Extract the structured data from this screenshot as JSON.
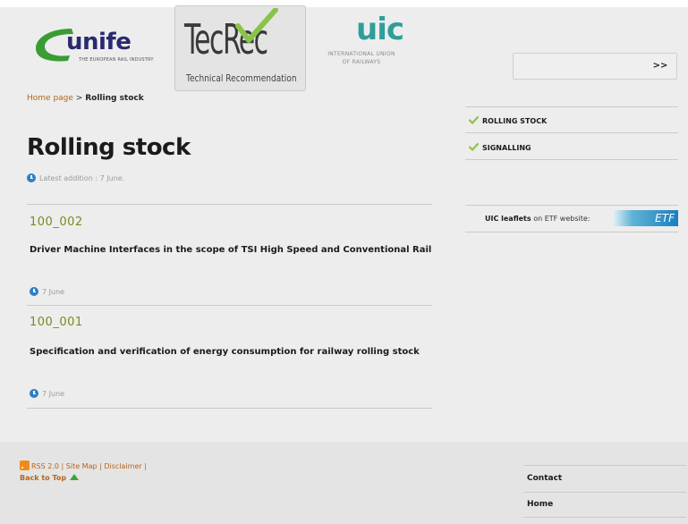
{
  "header": {
    "unife": {
      "word": "unife",
      "sub": "THE EUROPEAN RAIL INDUSTRY"
    },
    "tecrec": {
      "word": "TecRec",
      "sub": "Technical Recommendation"
    },
    "uic": {
      "word": "uic",
      "sub1": "INTERNATIONAL UNION",
      "sub2": "OF RAILWAYS"
    },
    "search": {
      "value": "",
      "placeholder": "",
      "go_label": ">>"
    }
  },
  "breadcrumb": {
    "home": "Home page",
    "separator": ">",
    "current": "Rolling stock"
  },
  "main": {
    "title": "Rolling stock",
    "latest": "Latest addition : 7 June.",
    "entries": [
      {
        "code": "100_002",
        "title": "Driver Machine Interfaces in the scope of TSI High Speed and Conventional Rail",
        "date": "7 June"
      },
      {
        "code": "100_001",
        "title": "Specification and verification of energy consumption for railway rolling stock",
        "date": "7 June"
      }
    ]
  },
  "sidebar": {
    "items": [
      {
        "label": "ROLLING STOCK"
      },
      {
        "label": "SIGNALLING"
      }
    ],
    "leaflets": {
      "bold": "UIC leaflets",
      "rest": "on ETF website:",
      "etf": "ETF"
    }
  },
  "footer": {
    "rss": "RSS 2.0",
    "sitemap": "Site Map",
    "disclaimer": "Disclaimer",
    "sep": "|",
    "back_to_top": "Back to Top",
    "nav": [
      {
        "label": "Contact"
      },
      {
        "label": "Home"
      }
    ]
  },
  "colors": {
    "accent_link": "#b5651d",
    "code_green": "#7a8a1e",
    "check_green": "#8bc34a",
    "clock_blue": "#2c7fc7",
    "uic_teal": "#2f9e9a",
    "unife_navy": "#2a2a6e"
  },
  "icons": [
    "check-icon",
    "clock-icon",
    "rss-icon",
    "up-arrow-icon",
    "unife-swoosh-icon",
    "tecrec-check-icon"
  ]
}
